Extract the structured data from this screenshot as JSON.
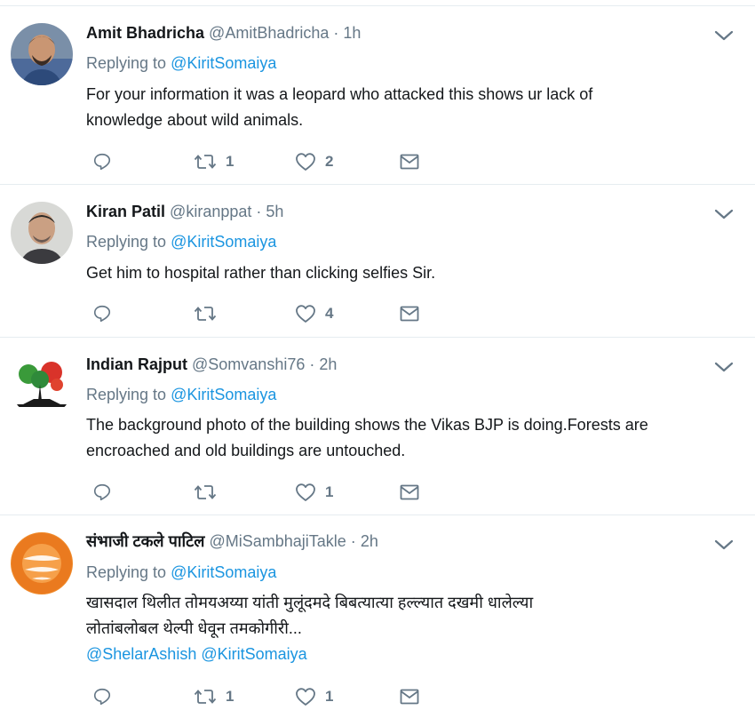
{
  "tweets": [
    {
      "name": "Amit Bhadricha",
      "handle": "@AmitBhadricha",
      "dot": "·",
      "time": "1h",
      "replying_prefix": "Replying to ",
      "replying_to": "@KiritSomaiya",
      "text_lines": [
        "For your information it was a leopard who attacked this shows ur lack of",
        "knowledge about wild animals."
      ],
      "mentions": "",
      "retweets": "1",
      "likes": "2"
    },
    {
      "name": "Kiran Patil",
      "handle": "@kiranppat",
      "dot": "·",
      "time": "5h",
      "replying_prefix": "Replying to ",
      "replying_to": "@KiritSomaiya",
      "text_lines": [
        "Get him to hospital rather than clicking selfies Sir.",
        ""
      ],
      "mentions": "",
      "retweets": "",
      "likes": "4"
    },
    {
      "name": "Indian Rajput",
      "handle": "@Somvanshi76",
      "dot": "·",
      "time": "2h",
      "replying_prefix": "Replying to ",
      "replying_to": "@KiritSomaiya",
      "text_lines": [
        "The background photo of the building shows the Vikas BJP is doing.Forests are",
        "encroached and old buildings are untouched."
      ],
      "mentions": "",
      "retweets": "",
      "likes": "1"
    },
    {
      "name": "संभाजी टकले पाटिल",
      "handle": "@MiSambhajiTakle",
      "dot": "·",
      "time": "2h",
      "replying_prefix": "Replying to ",
      "replying_to": "@KiritSomaiya",
      "text_lines": [
        "खासदाल थिलीत तोमयअय्या यांती मुलूंदमदे बिबत्यात्या हल्ल्यात दखमी धालेल्या",
        "लोतांबलोबल थेल्पी धेवून तमकोगीरी..."
      ],
      "mentions": "@ShelarAshish @KiritSomaiya",
      "retweets": "1",
      "likes": "1"
    }
  ],
  "icons": {
    "reply": "reply-icon",
    "retweet": "retweet-icon",
    "like": "heart-icon",
    "dm": "envelope-icon",
    "more": "chevron-down-icon"
  },
  "colors": {
    "link": "#1b95e0",
    "secondary": "#657786",
    "text": "#14171a",
    "divider": "#e6ecf0"
  }
}
